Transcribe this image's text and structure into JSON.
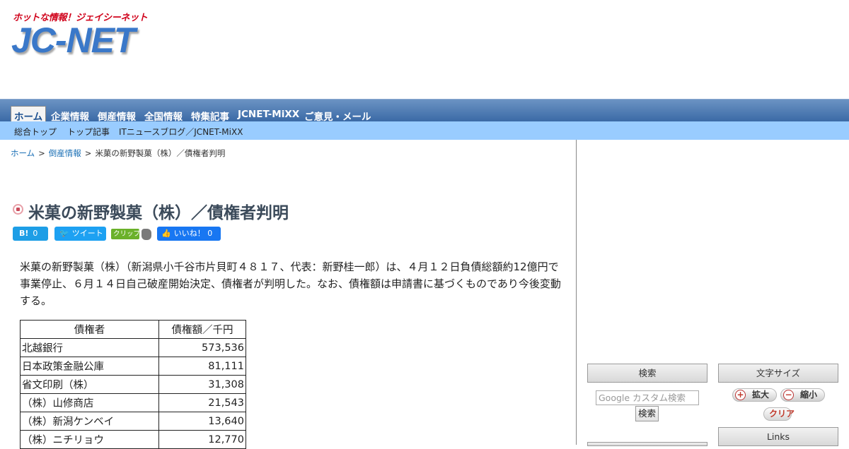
{
  "header": {
    "logo_tagline": "ホットな情報！ジェイシーネット",
    "logo_name": "JC-NET"
  },
  "nav": {
    "items": [
      {
        "label": "ホーム",
        "active": true
      },
      {
        "label": "企業情報"
      },
      {
        "label": "倒産情報"
      },
      {
        "label": "全国情報"
      },
      {
        "label": "特集記事"
      },
      {
        "label": "JCNET-MiXX"
      },
      {
        "label": "ご意見・メール"
      }
    ]
  },
  "subnav": {
    "items": [
      "総合トップ",
      "トップ記事",
      "ITニュースブログ／JCNET-MiXX"
    ]
  },
  "breadcrumb": {
    "home": "ホーム",
    "category": "倒産情報",
    "current": "米菓の新野製菓（株）／債権者判明",
    "separator": ">"
  },
  "article": {
    "title": "米菓の新野製菓（株）／債権者判明",
    "body": "米菓の新野製菓（株）（新潟県小千谷市片貝町４８１７、代表：新野桂一郎）は、４月１２日負債総額約12億円で事業停止、６月１４日自己破産開始決定、債権者が判明した。なお、債権額は申請書に基づくものであり今後変動する。"
  },
  "share": {
    "hatena_label": "B!",
    "hatena_count": "0",
    "tweet_label": "ツイート",
    "clip_label": "クリップ",
    "like_label": "いいね！",
    "like_count": "0"
  },
  "creditors": {
    "headers": [
      "債権者",
      "債権額／千円"
    ],
    "rows": [
      [
        "北越銀行",
        "573,536"
      ],
      [
        "日本政策金融公庫",
        "81,111"
      ],
      [
        "省文印刷（株）",
        "31,308"
      ],
      [
        "（株）山修商店",
        "21,543"
      ],
      [
        "（株）新潟ケンベイ",
        "13,640"
      ],
      [
        "（株）ニチリョウ",
        "12,770"
      ]
    ]
  },
  "sidebar": {
    "search_title": "検索",
    "search_placeholder": "Google カスタム検索",
    "search_button": "検索",
    "fontsize_title": "文字サイズ",
    "enlarge_label": "拡大",
    "shrink_label": "縮小",
    "clear_label": "クリア",
    "links_title": "Links"
  },
  "colors": {
    "nav_bg": "#3b6aa6",
    "subnav_bg": "#99ccff",
    "link": "#1a6fb5",
    "title": "#3b4a5a"
  }
}
